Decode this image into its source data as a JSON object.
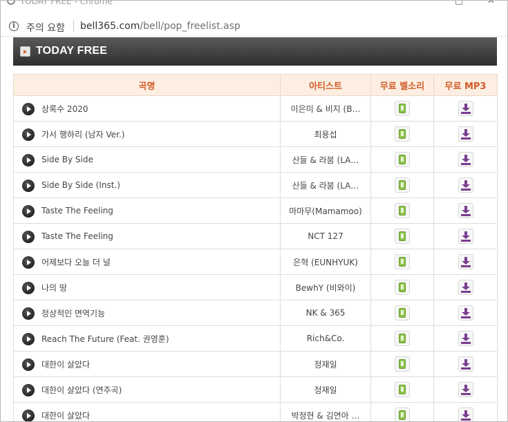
{
  "window": {
    "title": "TODAY FREE - Chrome",
    "minimize": "□",
    "close": "✕"
  },
  "address_bar": {
    "security_label": "주의 요함",
    "url_host": "bell365.com",
    "url_path": "/bell/pop_freelist.asp"
  },
  "banner": {
    "title": "TODAY FREE"
  },
  "table": {
    "headers": [
      "곡명",
      "아티스트",
      "무료 벨소리",
      "무료 MP3"
    ],
    "rows": [
      {
        "title": "상록수 2020",
        "artist": "이은미 & 비지 (B…"
      },
      {
        "title": "가서 행하리 (남자 Ver.)",
        "artist": "최용섭"
      },
      {
        "title": "Side By Side",
        "artist": "산들 & 라붐 (LA…"
      },
      {
        "title": "Side By Side (Inst.)",
        "artist": "산들 & 라붐 (LA…"
      },
      {
        "title": "Taste The Feeling",
        "artist": "마마무(Mamamoo)"
      },
      {
        "title": "Taste The Feeling",
        "artist": "NCT 127"
      },
      {
        "title": "어제보다 오늘 더 널",
        "artist": "은혁 (EUNHYUK)"
      },
      {
        "title": "나의 땅",
        "artist": "BewhY (비와이)"
      },
      {
        "title": "정상적인 면역기능",
        "artist": "NK & 365"
      },
      {
        "title": "Reach The Future (Feat. 권영훈)",
        "artist": "Rich&Co."
      },
      {
        "title": "대한이 살았다",
        "artist": "정재일"
      },
      {
        "title": "대한이 살았다 (연주곡)",
        "artist": "정재일"
      },
      {
        "title": "대한이 살았다",
        "artist": "박정현 & 김연아 …"
      }
    ]
  },
  "icons": {
    "bell": "phone-icon",
    "mp3": "download-icon",
    "play": "play-icon"
  },
  "colors": {
    "header_bg": "#fcefe2",
    "header_text": "#d25b28",
    "banner_bg": "#3a3a3a",
    "bell_green": "#8bc34a",
    "mp3_purple": "#7a3d8f"
  }
}
